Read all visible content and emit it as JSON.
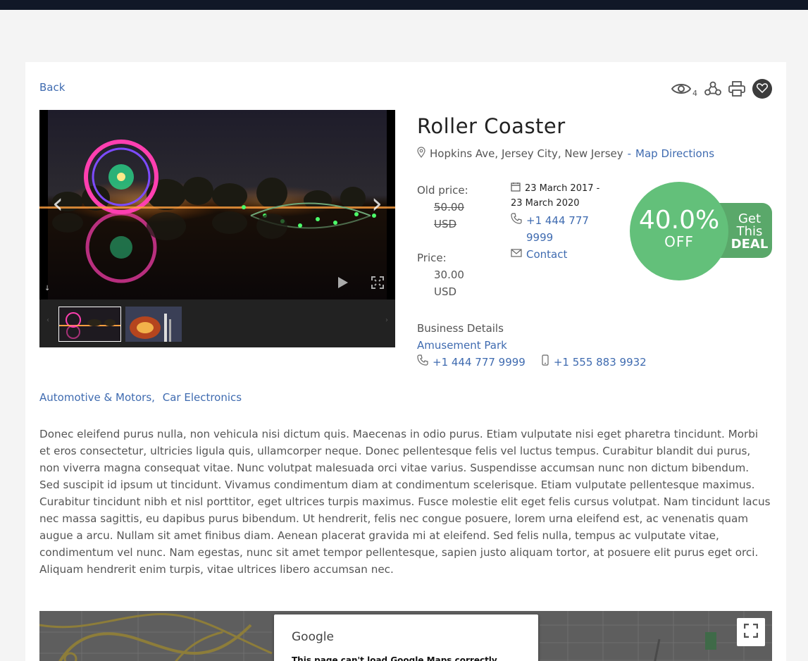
{
  "nav": {
    "back_label": "Back"
  },
  "toolbar": {
    "views_count": "4",
    "icons": [
      "eye-icon",
      "share-icon",
      "print-icon",
      "heart-icon"
    ]
  },
  "listing": {
    "title": "Roller Coaster",
    "address": "Hopkins Ave, Jersey City, New Jersey",
    "address_separator": "-",
    "map_directions_label": "Map Directions",
    "old_price_label": "Old price:",
    "old_price_amount": "50.00",
    "old_price_currency": "USD",
    "price_label": "Price:",
    "price_amount": "30.00",
    "price_currency": "USD",
    "dates_line1": "23 March 2017 -",
    "dates_line2": "23 March 2020",
    "phone_line1": "+1 444 777",
    "phone_line2": "9999",
    "contact_label": "Contact"
  },
  "deal": {
    "percent": "40.0%",
    "off": "OFF",
    "get": "Get",
    "this": "This",
    "deal": "DEAL",
    "circle_color": "#63c07a",
    "tab_color": "#5aa86a"
  },
  "business": {
    "label": "Business Details",
    "name": "Amusement Park",
    "phone": "+1 444 777 9999",
    "mobile": "+1 555 883 9932"
  },
  "categories": [
    {
      "label": "Automotive & Motors",
      "separator": ","
    },
    {
      "label": "Car Electronics",
      "separator": ""
    }
  ],
  "description": "Donec eleifend purus nulla, non vehicula nisi dictum quis. Maecenas in odio purus. Etiam vulputate nisi eget pharetra tincidunt. Morbi et eros consectetur, ultricies ligula quis, ullamcorper neque. Donec pellentesque felis vel luctus tempus. Curabitur blandit dui purus, non viverra magna consequat vitae. Nunc volutpat malesuada orci vitae varius. Suspendisse accumsan nunc non dictum bibendum. Sed suscipit id ipsum ut tincidunt. Vivamus condimentum diam at condimentum scelerisque. Etiam vulputate pellentesque maximus. Curabitur tincidunt nibh et nisl porttitor, eget ultrices turpis maximus. Fusce molestie elit eget felis cursus volutpat. Nam tincidunt lacus nec massa sagittis, eu dapibus purus bibendum. Ut hendrerit, felis nec congue posuere, lorem urna eleifend est, ac venenatis quam augue a arcu. Nullam sit amet finibus diam. Aenean placerat gravida mi at eleifend. Sed felis nulla, tempus ac vulputate vitae, condimentum vel nunc. Nam egestas, nunc sit amet tempor pellentesque, sapien justo aliquam tortor, at posuere elit purus eget orci. Aliquam hendrerit enim turpis, vitae ultrices libero accumsan nec.",
  "map": {
    "brand": "Google",
    "message": "This page can't load Google Maps correctly."
  },
  "colors": {
    "link": "#3f6bb0",
    "topbar": "#111827"
  }
}
